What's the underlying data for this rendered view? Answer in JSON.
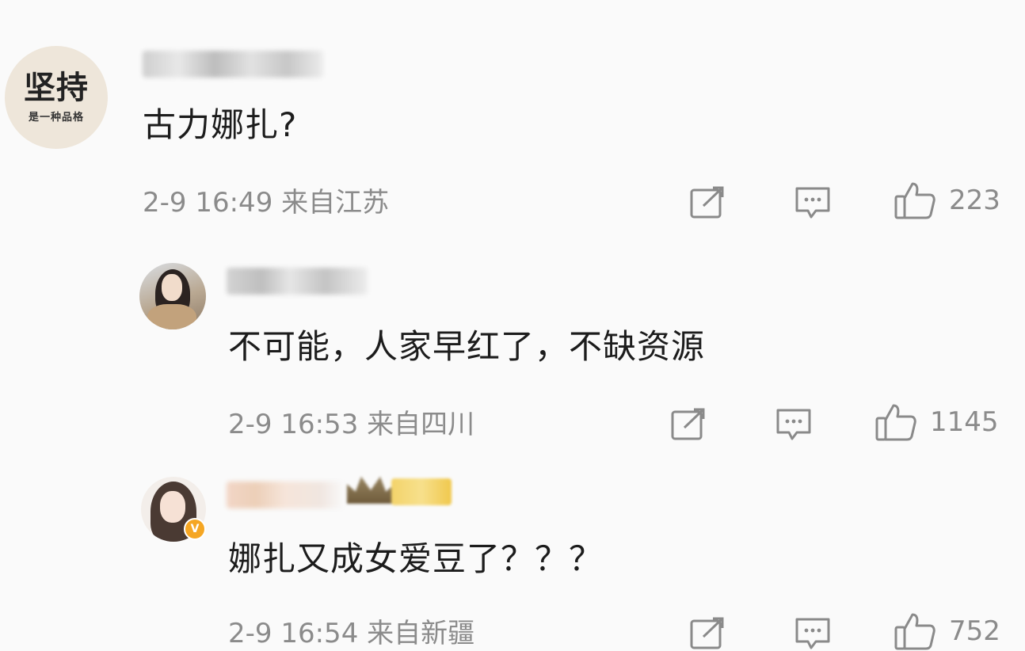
{
  "comments": [
    {
      "avatar": {
        "main_text": "坚持",
        "sub_text": "是一种品格"
      },
      "text": "古力娜扎?",
      "meta": "2-9 16:49  来自江苏",
      "likes": "223"
    },
    {
      "text": "不可能，人家早红了，不缺资源",
      "meta": "2-9 16:53  来自四川",
      "likes": "1145"
    },
    {
      "badge": "V",
      "text": "娜扎又成女爱豆了？？？",
      "meta": "2-9 16:54  来自新疆",
      "likes": "752"
    }
  ],
  "icons": {
    "share": "share-icon",
    "comment": "comment-icon",
    "like": "thumbs-up-icon"
  },
  "colors": {
    "background": "#fafafa",
    "text": "#1c1c1c",
    "meta": "#8b8b8b",
    "verified_badge": "#f5a623"
  }
}
